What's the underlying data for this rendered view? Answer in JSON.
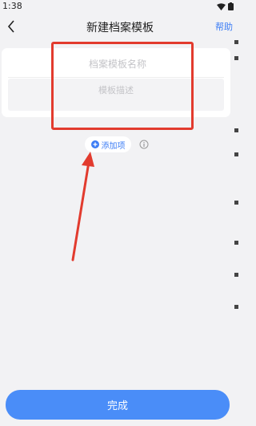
{
  "status": {
    "time": "1:38"
  },
  "nav": {
    "title": "新建档案模板",
    "help": "帮助"
  },
  "form": {
    "name_placeholder": "档案模板名称",
    "desc_placeholder": "模板描述"
  },
  "actions": {
    "add_item": "添加项",
    "done": "完成"
  },
  "colors": {
    "accent": "#4a8df8",
    "link": "#3d7df5",
    "annotation": "#e23b2e"
  },
  "icons": [
    "chevron-left-icon",
    "wifi-icon",
    "battery-icon",
    "plus-circle-icon",
    "info-icon"
  ]
}
